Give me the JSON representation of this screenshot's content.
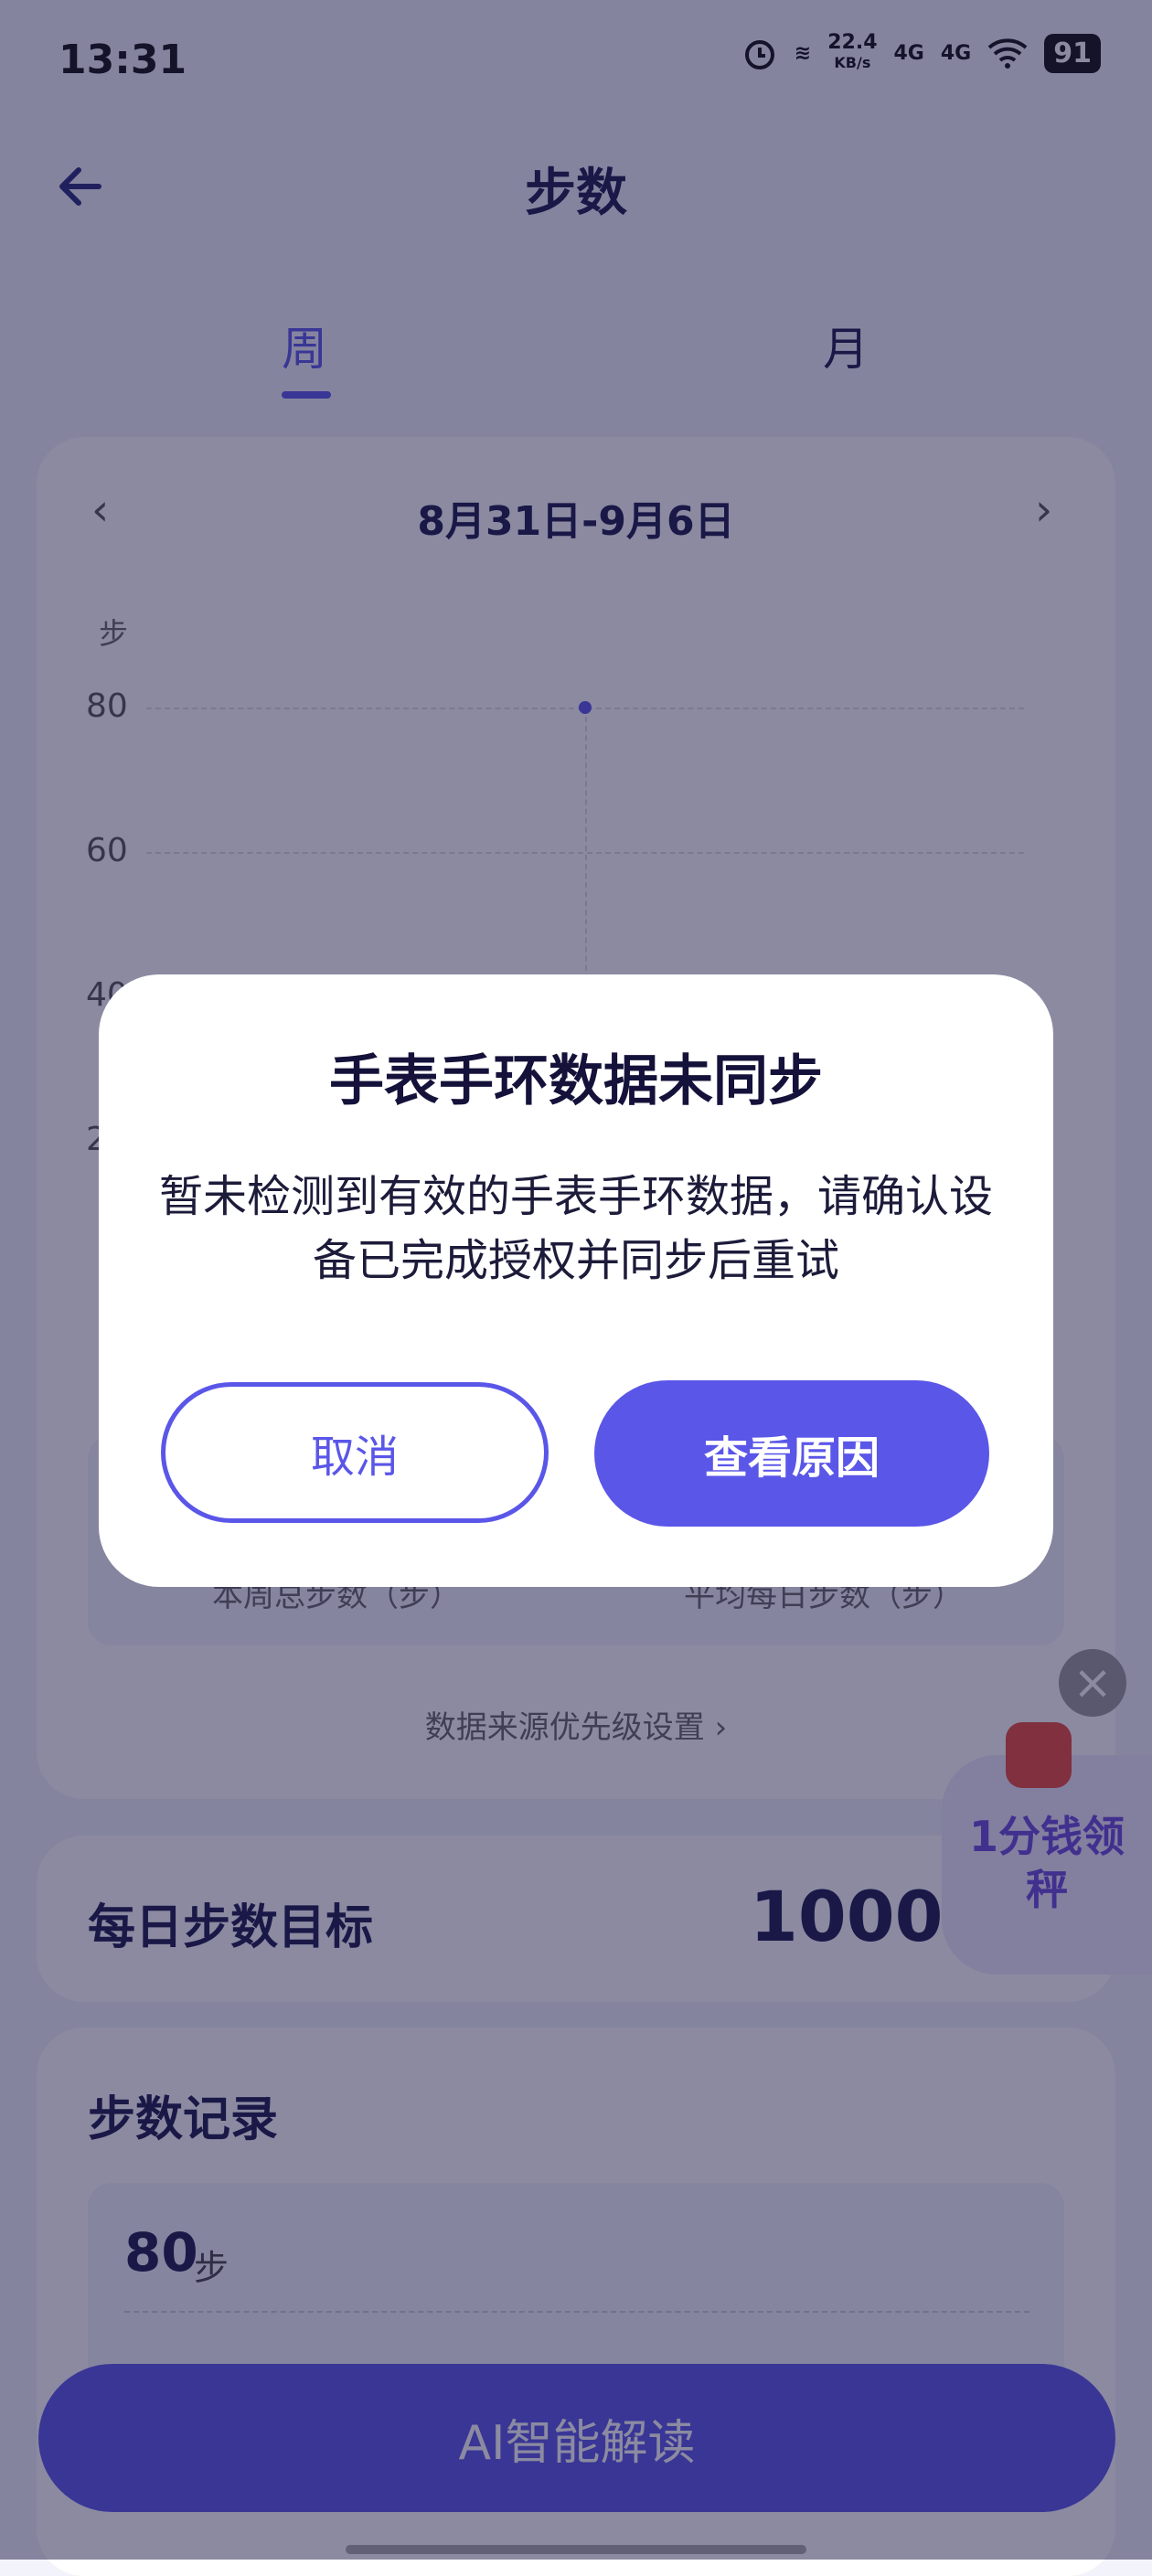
{
  "status_bar": {
    "time": "13:31",
    "speed_value": "22.4",
    "speed_unit": "KB/s",
    "signal1": "4G",
    "signal2": "4G",
    "battery": "91"
  },
  "header": {
    "title": "步数",
    "back_icon": "arrow-left-icon"
  },
  "tabs": [
    {
      "label": "周",
      "active": true
    },
    {
      "label": "月",
      "active": false
    }
  ],
  "chart_card": {
    "date_range": "8月31日-9月6日",
    "prev_icon": "chevron-left-icon",
    "next_icon": "chevron-right-icon",
    "summary_labels": [
      "本周总步数（步）",
      "平均每日步数（步）"
    ],
    "source_link": "数据来源优先级设置"
  },
  "chart_data": {
    "type": "scatter",
    "ylabel": "步",
    "ylim": [
      0,
      80
    ],
    "yticks": [
      "80",
      "60",
      "40",
      "20"
    ],
    "points": [
      {
        "x": 4,
        "y": 80
      }
    ]
  },
  "goal": {
    "label": "每日步数目标",
    "value": "10000"
  },
  "records": {
    "title": "步数记录",
    "value": "80",
    "unit": "步"
  },
  "ai_button": {
    "label": "AI智能解读"
  },
  "promo": {
    "text": "1分钱领秤"
  },
  "dialog": {
    "title": "手表手环数据未同步",
    "message": "暂未检测到有效的手表手环数据，请确认设备已完成授权并同步后重试",
    "cancel_label": "取消",
    "reason_label": "查看原因"
  },
  "colors": {
    "accent": "#5a56e8",
    "overlay": "rgba(24,22,68,0.5)"
  }
}
